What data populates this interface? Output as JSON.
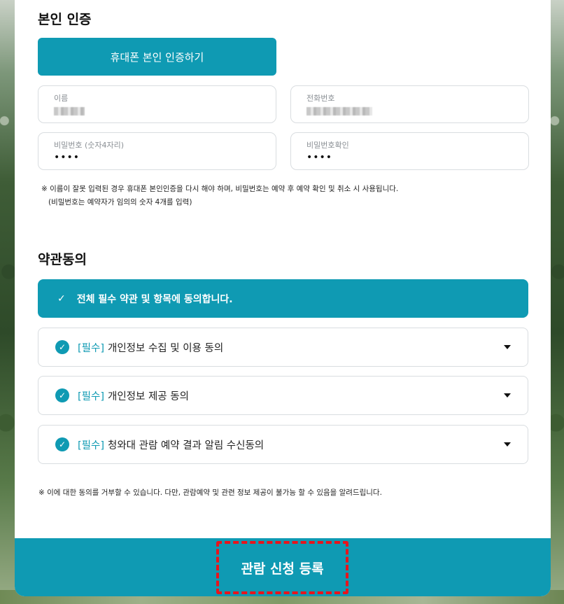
{
  "identity": {
    "title": "본인 인증",
    "verify_button": "휴대폰 본인 인증하기",
    "fields": {
      "name_label": "이름",
      "phone_label": "전화번호",
      "password_label": "비밀번호 (숫자4자리)",
      "password_value": "••••",
      "password_confirm_label": "비밀번호확인",
      "password_confirm_value": "••••"
    },
    "note_line1": "※ 이름이 잘못 입력된 경우 휴대폰 본인인증을 다시 해야 하며, 비밀번호는 예약 후 예약 확인 및 취소 시 사용됩니다.",
    "note_line2": "(비밀번호는 예약자가 임의의 숫자 4개를 입력)"
  },
  "terms": {
    "title": "약관동의",
    "agree_all": "전체 필수 약관 및 항목에 동의합니다.",
    "items": [
      {
        "tag": "[필수]",
        "label": "개인정보 수집 및 이용 동의"
      },
      {
        "tag": "[필수]",
        "label": "개인정보 제공 동의"
      },
      {
        "tag": "[필수]",
        "label": "청와대 관람 예약 결과 알림 수신동의"
      }
    ],
    "note": "※ 이에 대한 동의를 거부할 수 있습니다. 다만, 관람예약 및 관련 정보 제공이 불가능 할 수 있음을 알려드립니다."
  },
  "submit": {
    "label": "관람 신청 등록"
  },
  "colors": {
    "accent": "#0f9ab3",
    "highlight": "#e8141c"
  }
}
